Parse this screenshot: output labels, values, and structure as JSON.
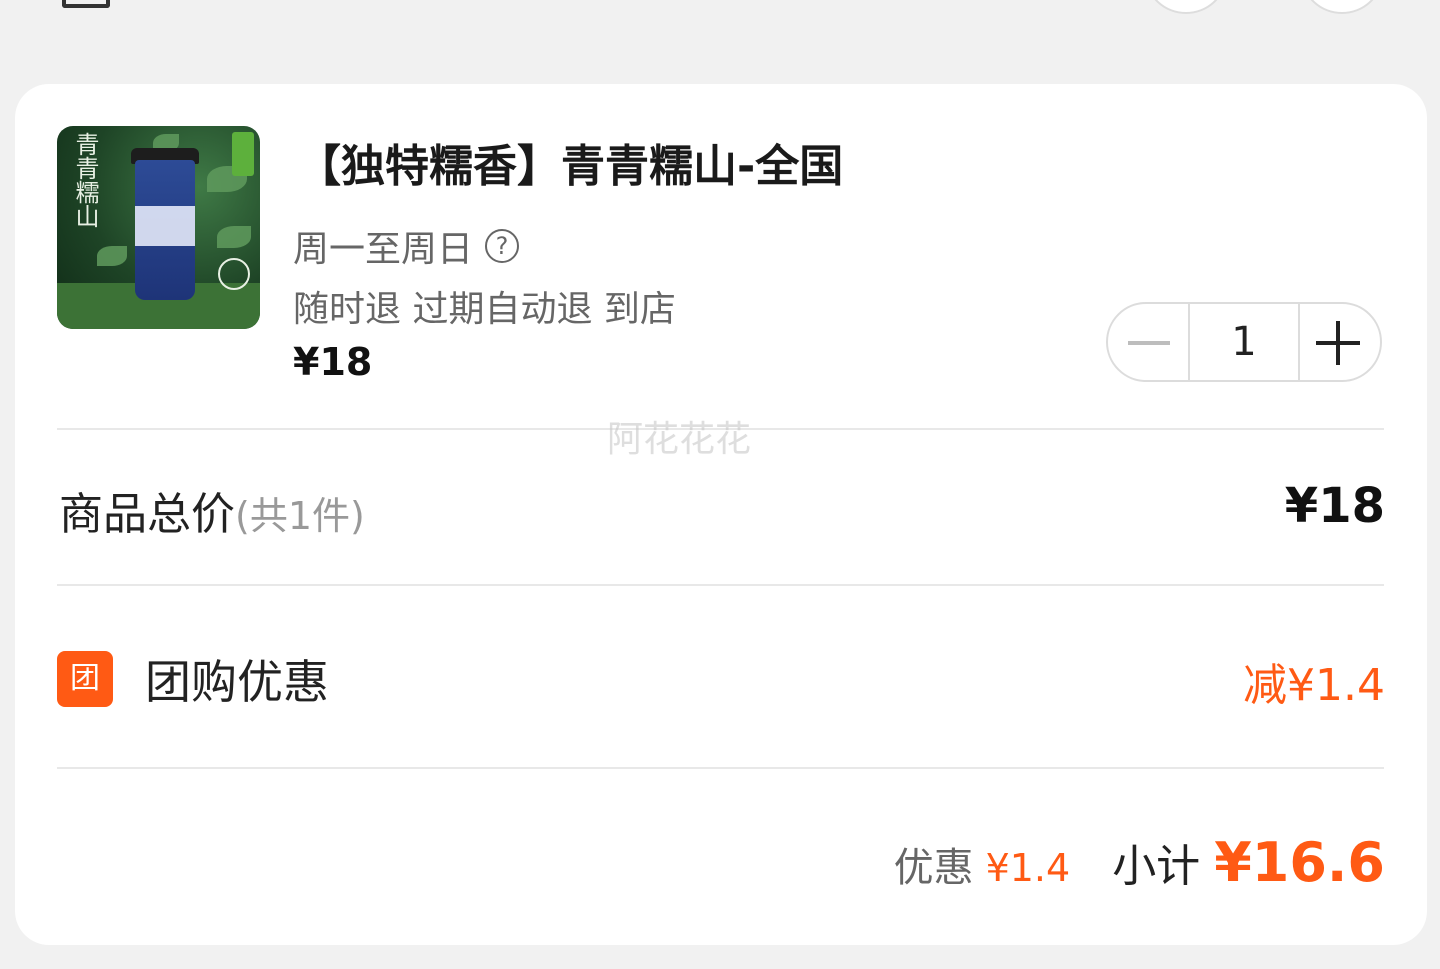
{
  "product": {
    "title": "【独特糯香】青青糯山-全国",
    "days": "周一至周日",
    "refund_info": "随时退 过期自动退 到店",
    "unit_price": "¥18",
    "image_text": "青青糯山",
    "image_alt": "青青糯山 drink cup product image"
  },
  "stepper": {
    "quantity": "1"
  },
  "watermark": "阿花花花",
  "summary": {
    "total_label": "商品总价",
    "total_count": "(共1件)",
    "total_value": "¥18"
  },
  "promotion": {
    "icon_text": "团",
    "label": "团购优惠",
    "value": "减¥1.4"
  },
  "footer": {
    "discount_label": "优惠",
    "discount_value": "¥1.4",
    "subtotal_label": "小计",
    "subtotal_value": "¥16.6"
  },
  "colors": {
    "accent": "#ff5a14",
    "background": "#f1f1f1",
    "card": "#ffffff"
  }
}
